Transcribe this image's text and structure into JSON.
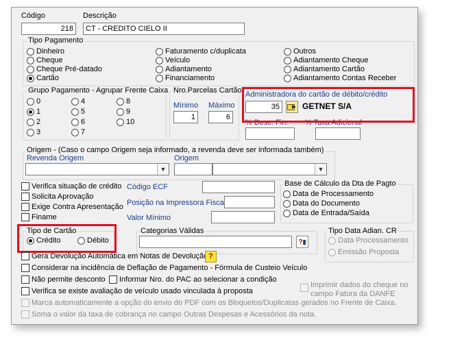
{
  "header": {
    "codigo_label": "Código",
    "codigo_value": "218",
    "descricao_label": "Descrição",
    "descricao_value": "CT - CREDITO CIELO II"
  },
  "tipo_pagamento": {
    "title": "Tipo Pagamento",
    "options": [
      "Dinheiro",
      "Cheque",
      "Cheque Pré-datado",
      "Cartão",
      "Faturamento c/duplicata",
      "Veículo",
      "Adiantamento",
      "Financiamento",
      "Outros",
      "Adiantamento Cheque",
      "Adiantamento Cartão",
      "Adiantamento Contas Receber"
    ],
    "selected": "Cartão"
  },
  "grupo_pagamento": {
    "title": "Grupo Pagamento - Agrupar Frente Caixa",
    "options": [
      "0",
      "1",
      "2",
      "3",
      "4",
      "5",
      "6",
      "7",
      "8",
      "9",
      "10"
    ],
    "selected": "1"
  },
  "parcelas": {
    "title": "Nro.Parcelas Cartão",
    "min_label": "Mínimo",
    "min_value": "1",
    "max_label": "Máximo",
    "max_value": "6"
  },
  "administradora": {
    "title": "Administradora do cartão de débito/crédito",
    "code": "35",
    "name": "GETNET S/A",
    "desc_fin_label": "% Desc. Fin.",
    "taxa_label": "% Taxa Adicional"
  },
  "origem": {
    "title": "Origem - (Caso o campo Origem seja informado, a revenda deve ser informada também)",
    "revenda_label": "Revenda Origem",
    "origem_label": "Origem"
  },
  "checks_top": {
    "verifica": "Verifica situação de crédito",
    "solicita": "Solicita Aprovação",
    "exige": "Exige Contra Apresentação",
    "finame": "Finame"
  },
  "fields_mid": {
    "codigo_ecf": "Código ECF",
    "posicao": "Posição na Impressora Fiscal",
    "valor_minimo": "Valor Mínimo"
  },
  "base_calculo": {
    "title": "Base de Cálculo da Dta de Pagto",
    "options": [
      "Data de Processamento",
      "Data do Documento",
      "Data de Entrada/Saída"
    ]
  },
  "tipo_cartao": {
    "title": "Tipo de Cartão",
    "credito": "Crédito",
    "debito": "Débito",
    "selected": "Crédito"
  },
  "categorias": {
    "title": "Categorias Válidas"
  },
  "tipo_data": {
    "title": "Tipo Data Adian. CR",
    "options": [
      "Data Processamento",
      "Emissão Proposta"
    ]
  },
  "checks_bottom": {
    "gera_devolucao": "Gera Devolução Automática em Notas de Devolução",
    "considerar": "Considerar na incidência de Deflação de Pagamento - Fórmula de Custeio Veículo",
    "nao_permite": "Não permite desconto",
    "informar_pac": "Informar Nro. do PAC ao selecionar a condição",
    "verifica_veiculo": "Verifica se existe avaliação de veículo usado vinculada à proposta",
    "imprimir_1": "Imprimir dados do cheque no",
    "imprimir_2": "campo Fatura da DANFE",
    "marca": "Marca automaticamente a opção do envio do PDF com os Bloquetos/Duplicatas gerados no Frente de Caixa.",
    "soma": "Soma o valor da taxa de cobrança no campo Outras Despesas e Acessórios da nota."
  },
  "icons": {
    "help": "help-question-icon",
    "lookup": "lookup-icon",
    "categorias_lookup": "question-lookup-icon"
  }
}
